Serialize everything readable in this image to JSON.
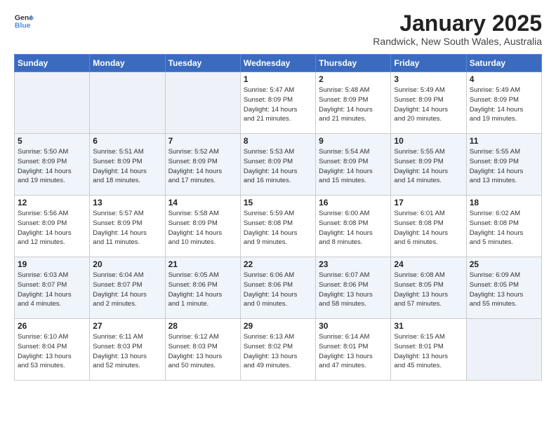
{
  "header": {
    "logo_line1": "General",
    "logo_line2": "Blue",
    "month": "January 2025",
    "location": "Randwick, New South Wales, Australia"
  },
  "days_of_week": [
    "Sunday",
    "Monday",
    "Tuesday",
    "Wednesday",
    "Thursday",
    "Friday",
    "Saturday"
  ],
  "weeks": [
    [
      {
        "day": "",
        "info": ""
      },
      {
        "day": "",
        "info": ""
      },
      {
        "day": "",
        "info": ""
      },
      {
        "day": "1",
        "info": "Sunrise: 5:47 AM\nSunset: 8:09 PM\nDaylight: 14 hours\nand 21 minutes."
      },
      {
        "day": "2",
        "info": "Sunrise: 5:48 AM\nSunset: 8:09 PM\nDaylight: 14 hours\nand 21 minutes."
      },
      {
        "day": "3",
        "info": "Sunrise: 5:49 AM\nSunset: 8:09 PM\nDaylight: 14 hours\nand 20 minutes."
      },
      {
        "day": "4",
        "info": "Sunrise: 5:49 AM\nSunset: 8:09 PM\nDaylight: 14 hours\nand 19 minutes."
      }
    ],
    [
      {
        "day": "5",
        "info": "Sunrise: 5:50 AM\nSunset: 8:09 PM\nDaylight: 14 hours\nand 19 minutes."
      },
      {
        "day": "6",
        "info": "Sunrise: 5:51 AM\nSunset: 8:09 PM\nDaylight: 14 hours\nand 18 minutes."
      },
      {
        "day": "7",
        "info": "Sunrise: 5:52 AM\nSunset: 8:09 PM\nDaylight: 14 hours\nand 17 minutes."
      },
      {
        "day": "8",
        "info": "Sunrise: 5:53 AM\nSunset: 8:09 PM\nDaylight: 14 hours\nand 16 minutes."
      },
      {
        "day": "9",
        "info": "Sunrise: 5:54 AM\nSunset: 8:09 PM\nDaylight: 14 hours\nand 15 minutes."
      },
      {
        "day": "10",
        "info": "Sunrise: 5:55 AM\nSunset: 8:09 PM\nDaylight: 14 hours\nand 14 minutes."
      },
      {
        "day": "11",
        "info": "Sunrise: 5:55 AM\nSunset: 8:09 PM\nDaylight: 14 hours\nand 13 minutes."
      }
    ],
    [
      {
        "day": "12",
        "info": "Sunrise: 5:56 AM\nSunset: 8:09 PM\nDaylight: 14 hours\nand 12 minutes."
      },
      {
        "day": "13",
        "info": "Sunrise: 5:57 AM\nSunset: 8:09 PM\nDaylight: 14 hours\nand 11 minutes."
      },
      {
        "day": "14",
        "info": "Sunrise: 5:58 AM\nSunset: 8:09 PM\nDaylight: 14 hours\nand 10 minutes."
      },
      {
        "day": "15",
        "info": "Sunrise: 5:59 AM\nSunset: 8:08 PM\nDaylight: 14 hours\nand 9 minutes."
      },
      {
        "day": "16",
        "info": "Sunrise: 6:00 AM\nSunset: 8:08 PM\nDaylight: 14 hours\nand 8 minutes."
      },
      {
        "day": "17",
        "info": "Sunrise: 6:01 AM\nSunset: 8:08 PM\nDaylight: 14 hours\nand 6 minutes."
      },
      {
        "day": "18",
        "info": "Sunrise: 6:02 AM\nSunset: 8:08 PM\nDaylight: 14 hours\nand 5 minutes."
      }
    ],
    [
      {
        "day": "19",
        "info": "Sunrise: 6:03 AM\nSunset: 8:07 PM\nDaylight: 14 hours\nand 4 minutes."
      },
      {
        "day": "20",
        "info": "Sunrise: 6:04 AM\nSunset: 8:07 PM\nDaylight: 14 hours\nand 2 minutes."
      },
      {
        "day": "21",
        "info": "Sunrise: 6:05 AM\nSunset: 8:06 PM\nDaylight: 14 hours\nand 1 minute."
      },
      {
        "day": "22",
        "info": "Sunrise: 6:06 AM\nSunset: 8:06 PM\nDaylight: 14 hours\nand 0 minutes."
      },
      {
        "day": "23",
        "info": "Sunrise: 6:07 AM\nSunset: 8:06 PM\nDaylight: 13 hours\nand 58 minutes."
      },
      {
        "day": "24",
        "info": "Sunrise: 6:08 AM\nSunset: 8:05 PM\nDaylight: 13 hours\nand 57 minutes."
      },
      {
        "day": "25",
        "info": "Sunrise: 6:09 AM\nSunset: 8:05 PM\nDaylight: 13 hours\nand 55 minutes."
      }
    ],
    [
      {
        "day": "26",
        "info": "Sunrise: 6:10 AM\nSunset: 8:04 PM\nDaylight: 13 hours\nand 53 minutes."
      },
      {
        "day": "27",
        "info": "Sunrise: 6:11 AM\nSunset: 8:03 PM\nDaylight: 13 hours\nand 52 minutes."
      },
      {
        "day": "28",
        "info": "Sunrise: 6:12 AM\nSunset: 8:03 PM\nDaylight: 13 hours\nand 50 minutes."
      },
      {
        "day": "29",
        "info": "Sunrise: 6:13 AM\nSunset: 8:02 PM\nDaylight: 13 hours\nand 49 minutes."
      },
      {
        "day": "30",
        "info": "Sunrise: 6:14 AM\nSunset: 8:01 PM\nDaylight: 13 hours\nand 47 minutes."
      },
      {
        "day": "31",
        "info": "Sunrise: 6:15 AM\nSunset: 8:01 PM\nDaylight: 13 hours\nand 45 minutes."
      },
      {
        "day": "",
        "info": ""
      }
    ]
  ]
}
